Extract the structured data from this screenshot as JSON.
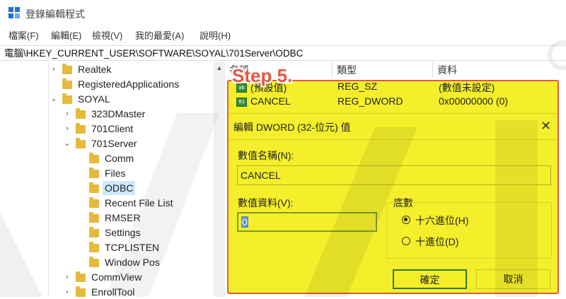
{
  "window": {
    "title": "登錄編輯程式"
  },
  "menu": [
    "檔案(F)",
    "編輯(E)",
    "檢視(V)",
    "我的最愛(A)",
    "說明(H)"
  ],
  "address_path": "電腦\\HKEY_CURRENT_USER\\SOFTWARE\\SOYAL\\701Server\\ODBC",
  "tree": {
    "items": [
      {
        "label": "Realtek",
        "chevron": "›"
      },
      {
        "label": "RegisteredApplications",
        "chevron": ""
      },
      {
        "label": "SOYAL",
        "chevron": "⌄"
      },
      {
        "label": "323DMaster",
        "chevron": "›"
      },
      {
        "label": "701Client",
        "chevron": "›"
      },
      {
        "label": "701Server",
        "chevron": "⌄"
      },
      {
        "label": "Comm",
        "chevron": ""
      },
      {
        "label": "Files",
        "chevron": ""
      },
      {
        "label": "ODBC",
        "chevron": ""
      },
      {
        "label": "Recent File List",
        "chevron": ""
      },
      {
        "label": "RMSER",
        "chevron": ""
      },
      {
        "label": "Settings",
        "chevron": ""
      },
      {
        "label": "TCPLISTEN",
        "chevron": ""
      },
      {
        "label": "Window Pos",
        "chevron": ""
      },
      {
        "label": "CommView",
        "chevron": "›"
      },
      {
        "label": "EnrollTool",
        "chevron": "›"
      }
    ],
    "selected": "ODBC"
  },
  "list": {
    "columns": [
      "名稱",
      "類型",
      "資料"
    ],
    "rows": [
      {
        "name": "(預設值)",
        "type": "REG_SZ",
        "data": "(數值未設定)"
      },
      {
        "name": "CANCEL",
        "type": "REG_DWORD",
        "data": "0x00000000 (0)"
      }
    ]
  },
  "step_label": "Step 5.",
  "dialog": {
    "title": "編輯 DWORD (32-位元) 值",
    "value_name_label": "數值名稱(N):",
    "value_name": "CANCEL",
    "value_data_label": "數值資料(V):",
    "value_data": "0",
    "base_label": "底數",
    "base_options": [
      "十六進位(H)",
      "十進位(D)"
    ],
    "base_selected": "十六進位(H)",
    "ok_label": "確定",
    "cancel_label": "取消"
  },
  "colors": {
    "highlight": "#f4ef2a",
    "step_text": "#e8553e",
    "border": "#e05a3a"
  }
}
